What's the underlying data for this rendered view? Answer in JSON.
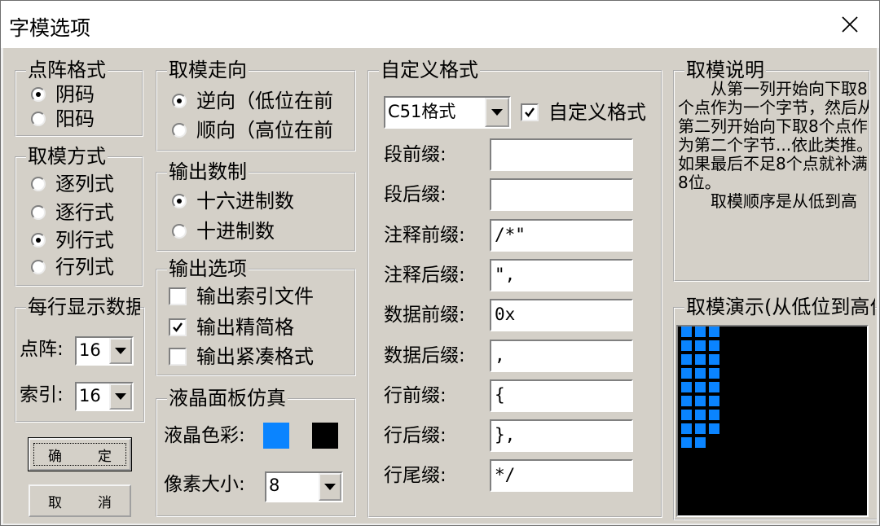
{
  "window": {
    "title": "字模选项"
  },
  "groups": {
    "dot_format": {
      "title": "点阵格式",
      "options": [
        "阴码",
        "阳码"
      ],
      "selected": 0
    },
    "scan_dir": {
      "title": "取模走向",
      "options": [
        "逆向（低位在前",
        "顺向（高位在前"
      ],
      "selected": 0
    },
    "scan_mode": {
      "title": "取模方式",
      "options": [
        "逐列式",
        "逐行式",
        "列行式",
        "行列式"
      ],
      "selected": 2
    },
    "radix": {
      "title": "输出数制",
      "options": [
        "十六进制数",
        "十进制数"
      ],
      "selected": 0
    },
    "out_opts": {
      "title": "输出选项",
      "items": [
        {
          "label": "输出索引文件",
          "checked": false
        },
        {
          "label": "输出精简格",
          "checked": true
        },
        {
          "label": "输出紧凑格式",
          "checked": false
        }
      ]
    },
    "per_line": {
      "title": "每行显示数据",
      "dot_label": "点阵:",
      "dot_value": "16",
      "index_label": "索引:",
      "index_value": "16"
    },
    "lcd": {
      "title": "液晶面板仿真",
      "color_label": "液晶色彩:",
      "fg_color": "#0a84ff",
      "bg_color": "#000000",
      "pixel_label": "像素大小:",
      "pixel_value": "8"
    },
    "custom": {
      "title": "自定义格式",
      "format_value": "C51格式",
      "custom_check_label": "自定义格式",
      "custom_checked": true,
      "fields": [
        {
          "label": "段前缀:",
          "value": ""
        },
        {
          "label": "段后缀:",
          "value": ""
        },
        {
          "label": "注释前缀:",
          "value": "/*\""
        },
        {
          "label": "注释后缀:",
          "value": "\","
        },
        {
          "label": "数据前缀:",
          "value": "0x"
        },
        {
          "label": "数据后缀:",
          "value": ","
        },
        {
          "label": "行前缀:",
          "value": "{"
        },
        {
          "label": "行后缀:",
          "value": "},"
        },
        {
          "label": "行尾缀:",
          "value": "*/"
        }
      ]
    },
    "desc": {
      "title": "取模说明",
      "text": "　　从第一列开始向下取8个点作为一个字节，然后从第二列开始向下取8个点作为第二个字节...依此类推。如果最后不足8个点就补满8位。\n　　取模顺序是从低到高"
    },
    "demo": {
      "title": "取模演示(从低位到高位)",
      "fill_rows": 9,
      "fill_cols": 3,
      "last_row_cols": 2
    }
  },
  "buttons": {
    "ok": [
      "确",
      "定"
    ],
    "cancel": [
      "取",
      "消"
    ]
  }
}
